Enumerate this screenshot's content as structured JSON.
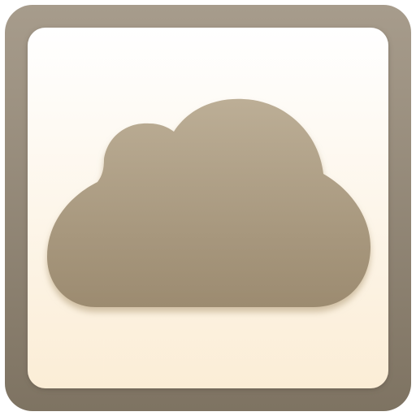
{
  "icon": {
    "name": "cloud-icon",
    "frame_color_top": "#a79c8c",
    "frame_color_bottom": "#7e7362",
    "panel_color_top": "#ffffff",
    "panel_color_bottom": "#fbedd6",
    "cloud_color_top": "#bcae96",
    "cloud_color_bottom": "#9c8b70"
  }
}
